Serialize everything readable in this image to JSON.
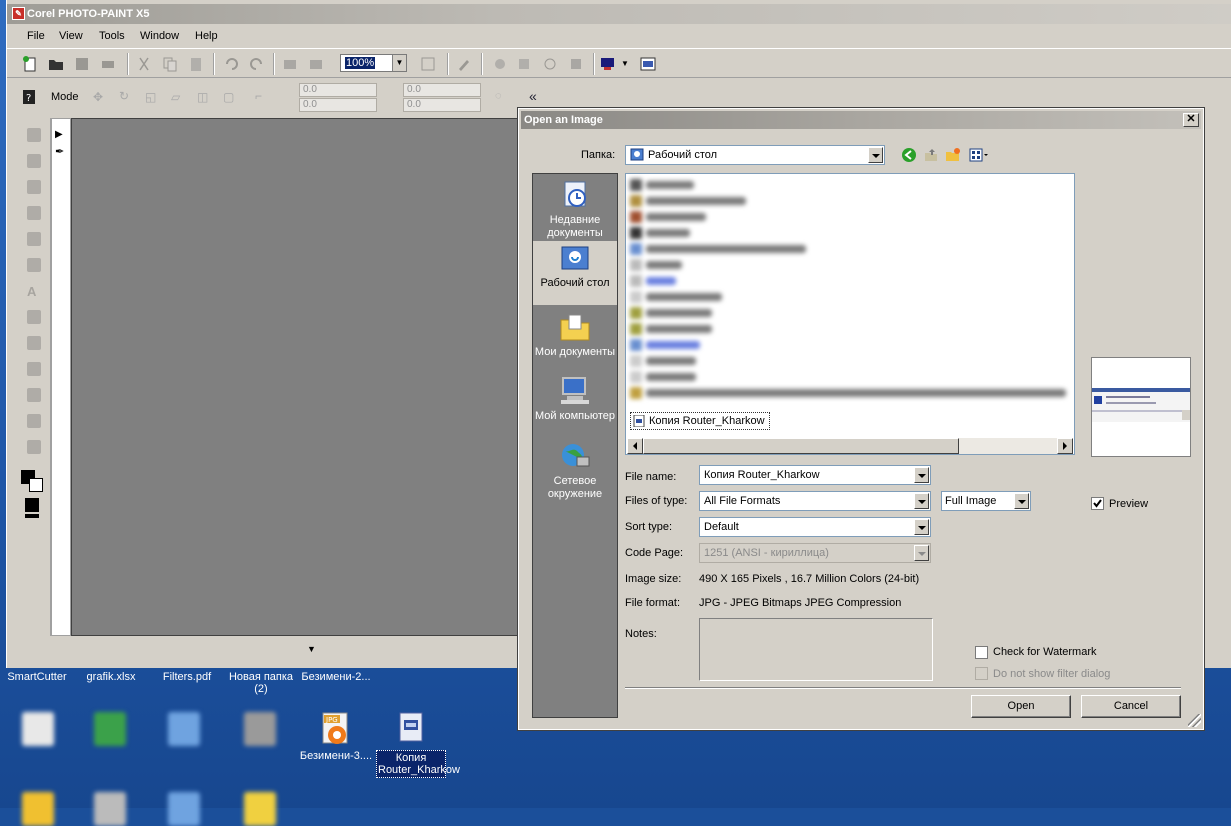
{
  "app": {
    "title": "Corel PHOTO-PAINT X5",
    "menu": [
      "File",
      "View",
      "Tools",
      "Window",
      "Help"
    ],
    "zoom": "100%",
    "mode_label": "Mode",
    "spin_values": [
      "0.0",
      "0.0",
      "0.0",
      "0.0"
    ]
  },
  "desktop": {
    "top_labels": [
      "SmartCutter",
      "grafik.xlsx",
      "Filters.pdf",
      "Новая папка",
      "(2)",
      "Безимени-2..."
    ],
    "icons": [
      {
        "label": "Безимени-3....",
        "icon": "jpg-file-icon"
      },
      {
        "label": "Копия Router_Kharkow",
        "icon": "image-file-icon"
      }
    ]
  },
  "dialog": {
    "title": "Open an Image",
    "look_in_label": "Папка:",
    "look_in_value": "Рабочий стол",
    "places": [
      {
        "label": "Недавние документы",
        "icon": "recent-documents-icon",
        "selected": false
      },
      {
        "label": "Рабочий стол",
        "icon": "desktop-icon",
        "selected": true
      },
      {
        "label": "Мои документы",
        "icon": "my-documents-icon",
        "selected": false
      },
      {
        "label": "Мой компьютер",
        "icon": "my-computer-icon",
        "selected": false
      },
      {
        "label": "Сетевое окружение",
        "icon": "network-icon",
        "selected": false
      }
    ],
    "selected_file": "Копия Router_Kharkow",
    "file_name_label": "File name:",
    "file_name_value": "Копия Router_Kharkow",
    "files_of_type_label": "Files of type:",
    "files_of_type_value": "All File Formats",
    "image_mode_value": "Full Image",
    "preview_label": "Preview",
    "preview_checked": true,
    "sort_type_label": "Sort type:",
    "sort_type_value": "Default",
    "code_page_label": "Code Page:",
    "code_page_value": "1251  (ANSI - кириллица)",
    "image_size_label": "Image size:",
    "image_size_value": "490 X 165 Pixels , 16.7 Million Colors (24-bit)",
    "file_format_label": "File format:",
    "file_format_value": "JPG - JPEG Bitmaps JPEG Compression",
    "notes_label": "Notes:",
    "check_watermark_label": "Check for Watermark",
    "no_filter_dialog_label": "Do not show filter dialog",
    "open_button": "Open",
    "cancel_button": "Cancel"
  },
  "colors": {
    "accent_blue": "#0a246a",
    "dialog_bg": "#d4d0c8",
    "places_bg": "#808080"
  }
}
